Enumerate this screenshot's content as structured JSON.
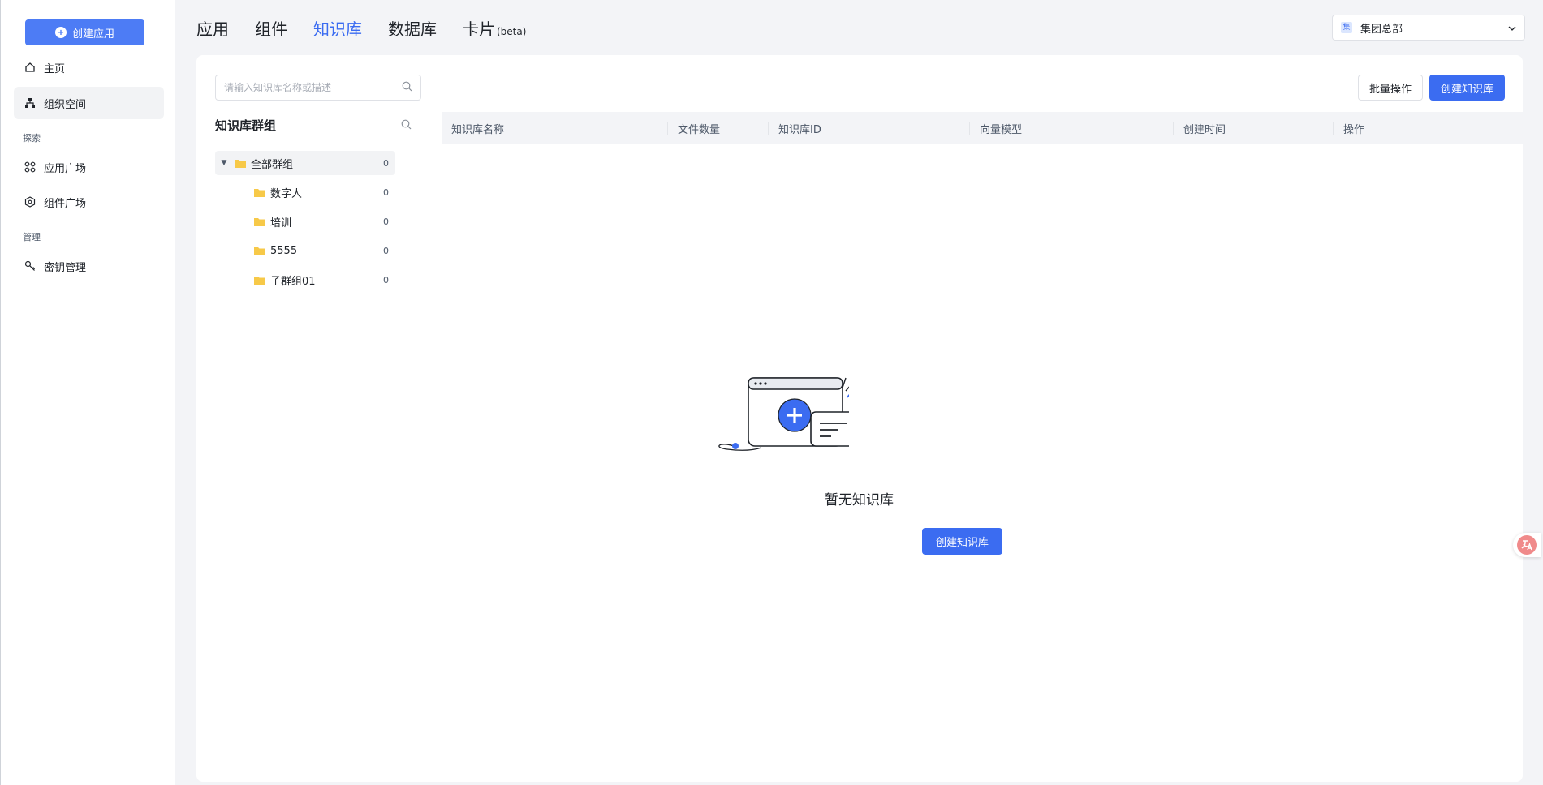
{
  "sidebar": {
    "create_button": "创建应用",
    "items": [
      {
        "label": "主页",
        "icon": "home-icon"
      },
      {
        "label": "组织空间",
        "icon": "org-tree-icon"
      },
      {
        "label": "应用广场",
        "icon": "apps-grid-icon"
      },
      {
        "label": "组件广场",
        "icon": "component-hex-icon"
      },
      {
        "label": "密钥管理",
        "icon": "key-icon"
      }
    ],
    "sections": {
      "explore": "探索",
      "manage": "管理"
    }
  },
  "tabs": [
    {
      "label": "应用"
    },
    {
      "label": "组件"
    },
    {
      "label": "知识库"
    },
    {
      "label": "数据库"
    },
    {
      "label": "卡片",
      "suffix": "(beta)"
    }
  ],
  "org_select": {
    "badge": "集",
    "value": "集团总部"
  },
  "search": {
    "placeholder": "请输入知识库名称或描述"
  },
  "actions": {
    "batch": "批量操作",
    "create": "创建知识库"
  },
  "groups": {
    "title": "知识库群组",
    "items": [
      {
        "name": "全部群组",
        "count": "0"
      },
      {
        "name": "数字人",
        "count": "0"
      },
      {
        "name": "培训",
        "count": "0"
      },
      {
        "name": "5555",
        "count": "0"
      },
      {
        "name": "子群组01",
        "count": "0"
      }
    ]
  },
  "table": {
    "columns": [
      "知识库名称",
      "文件数量",
      "知识库ID",
      "向量模型",
      "创建时间",
      "操作"
    ]
  },
  "empty": {
    "text": "暂无知识库",
    "button": "创建知识库"
  },
  "colors": {
    "primary": "#3b6cf1",
    "folder": "#f7c948",
    "background": "#f3f4f7"
  }
}
